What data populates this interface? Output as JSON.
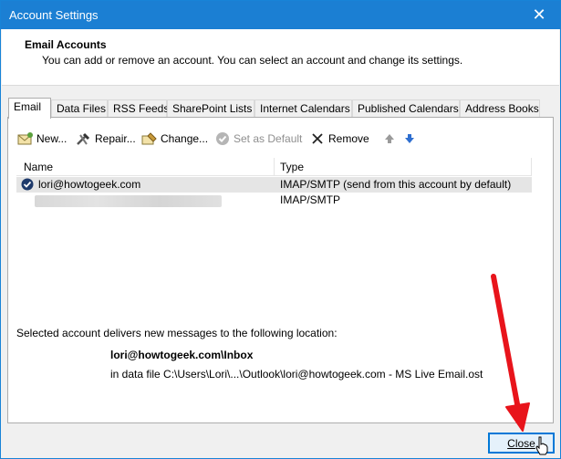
{
  "window": {
    "title": "Account Settings"
  },
  "header": {
    "title": "Email Accounts",
    "description": "You can add or remove an account. You can select an account and change its settings."
  },
  "tabs": [
    {
      "label": "Email",
      "active": true
    },
    {
      "label": "Data Files"
    },
    {
      "label": "RSS Feeds"
    },
    {
      "label": "SharePoint Lists"
    },
    {
      "label": "Internet Calendars"
    },
    {
      "label": "Published Calendars"
    },
    {
      "label": "Address Books"
    }
  ],
  "toolbar": {
    "new": "New...",
    "repair": "Repair...",
    "change": "Change...",
    "set_default": "Set as Default",
    "remove": "Remove"
  },
  "accounts": {
    "columns": [
      "Name",
      "Type"
    ],
    "rows": [
      {
        "name": "lori@howtogeek.com",
        "type": "IMAP/SMTP (send from this account by default)",
        "default": true,
        "selected": true
      },
      {
        "name": "",
        "type": "IMAP/SMTP",
        "redacted": true
      }
    ]
  },
  "delivery": {
    "label": "Selected account delivers new messages to the following location:",
    "folder": "lori@howtogeek.com\\Inbox",
    "file": "in data file C:\\Users\\Lori\\...\\Outlook\\lori@howtogeek.com - MS Live Email.ost"
  },
  "footer": {
    "close_label": "Close"
  },
  "colors": {
    "titlebar": "#1b7fd3",
    "annotation_arrow": "#e8141b",
    "accent": "#0078d7"
  }
}
